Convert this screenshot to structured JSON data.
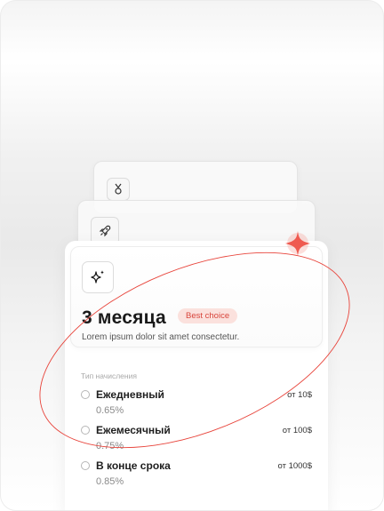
{
  "back_cards": [
    {
      "icon": "medal-icon"
    },
    {
      "icon": "rocket-icon"
    }
  ],
  "plan": {
    "icon": "sparkles-icon",
    "title": "3 месяца",
    "badge": "Best choice",
    "description": "Lorem ipsum dolor sit amet consectetur."
  },
  "accrual": {
    "label": "Тип начисления",
    "options": [
      {
        "name": "Ежедневный",
        "rate": "0.65%",
        "min": "от 10$"
      },
      {
        "name": "Ежемесячный",
        "rate": "0.75%",
        "min": "от 100$"
      },
      {
        "name": "В конце срока",
        "rate": "0.85%",
        "min": "от 1000$"
      }
    ]
  },
  "colors": {
    "accent": "#e8453c",
    "badge_bg": "#fbe1dd"
  }
}
